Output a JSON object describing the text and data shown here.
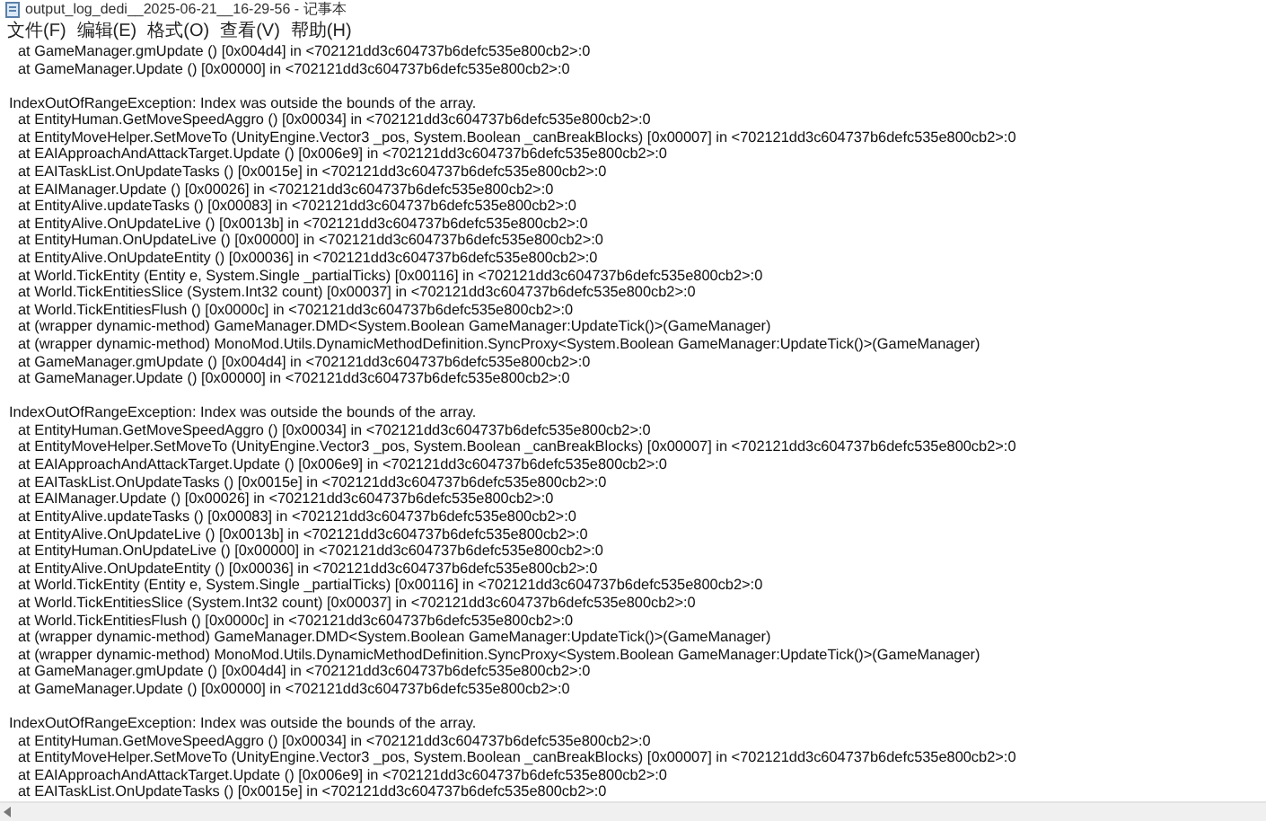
{
  "window": {
    "title": "output_log_dedi__2025-06-21__16-29-56 - 记事本"
  },
  "menu": [
    {
      "label": "文件(F)"
    },
    {
      "label": "编辑(E)"
    },
    {
      "label": "格式(O)"
    },
    {
      "label": "查看(V)"
    },
    {
      "label": "帮助(H)"
    }
  ],
  "log": {
    "blocks": [
      {
        "frames": [
          "at GameManager.gmUpdate () [0x004d4] in <702121dd3c604737b6defc535e800cb2>:0",
          "at GameManager.Update () [0x00000] in <702121dd3c604737b6defc535e800cb2>:0"
        ]
      },
      {
        "header": "IndexOutOfRangeException: Index was outside the bounds of the array.",
        "frames": [
          "at EntityHuman.GetMoveSpeedAggro () [0x00034] in <702121dd3c604737b6defc535e800cb2>:0",
          "at EntityMoveHelper.SetMoveTo (UnityEngine.Vector3 _pos, System.Boolean _canBreakBlocks) [0x00007] in <702121dd3c604737b6defc535e800cb2>:0",
          "at EAIApproachAndAttackTarget.Update () [0x006e9] in <702121dd3c604737b6defc535e800cb2>:0",
          "at EAITaskList.OnUpdateTasks () [0x0015e] in <702121dd3c604737b6defc535e800cb2>:0",
          "at EAIManager.Update () [0x00026] in <702121dd3c604737b6defc535e800cb2>:0",
          "at EntityAlive.updateTasks () [0x00083] in <702121dd3c604737b6defc535e800cb2>:0",
          "at EntityAlive.OnUpdateLive () [0x0013b] in <702121dd3c604737b6defc535e800cb2>:0",
          "at EntityHuman.OnUpdateLive () [0x00000] in <702121dd3c604737b6defc535e800cb2>:0",
          "at EntityAlive.OnUpdateEntity () [0x00036] in <702121dd3c604737b6defc535e800cb2>:0",
          "at World.TickEntity (Entity e, System.Single _partialTicks) [0x00116] in <702121dd3c604737b6defc535e800cb2>:0",
          "at World.TickEntitiesSlice (System.Int32 count) [0x00037] in <702121dd3c604737b6defc535e800cb2>:0",
          "at World.TickEntitiesFlush () [0x0000c] in <702121dd3c604737b6defc535e800cb2>:0",
          "at (wrapper dynamic-method) GameManager.DMD<System.Boolean GameManager:UpdateTick()>(GameManager)",
          "at (wrapper dynamic-method) MonoMod.Utils.DynamicMethodDefinition.SyncProxy<System.Boolean GameManager:UpdateTick()>(GameManager)",
          "at GameManager.gmUpdate () [0x004d4] in <702121dd3c604737b6defc535e800cb2>:0",
          "at GameManager.Update () [0x00000] in <702121dd3c604737b6defc535e800cb2>:0"
        ]
      },
      {
        "header": "IndexOutOfRangeException: Index was outside the bounds of the array.",
        "frames": [
          "at EntityHuman.GetMoveSpeedAggro () [0x00034] in <702121dd3c604737b6defc535e800cb2>:0",
          "at EntityMoveHelper.SetMoveTo (UnityEngine.Vector3 _pos, System.Boolean _canBreakBlocks) [0x00007] in <702121dd3c604737b6defc535e800cb2>:0",
          "at EAIApproachAndAttackTarget.Update () [0x006e9] in <702121dd3c604737b6defc535e800cb2>:0",
          "at EAITaskList.OnUpdateTasks () [0x0015e] in <702121dd3c604737b6defc535e800cb2>:0",
          "at EAIManager.Update () [0x00026] in <702121dd3c604737b6defc535e800cb2>:0",
          "at EntityAlive.updateTasks () [0x00083] in <702121dd3c604737b6defc535e800cb2>:0",
          "at EntityAlive.OnUpdateLive () [0x0013b] in <702121dd3c604737b6defc535e800cb2>:0",
          "at EntityHuman.OnUpdateLive () [0x00000] in <702121dd3c604737b6defc535e800cb2>:0",
          "at EntityAlive.OnUpdateEntity () [0x00036] in <702121dd3c604737b6defc535e800cb2>:0",
          "at World.TickEntity (Entity e, System.Single _partialTicks) [0x00116] in <702121dd3c604737b6defc535e800cb2>:0",
          "at World.TickEntitiesSlice (System.Int32 count) [0x00037] in <702121dd3c604737b6defc535e800cb2>:0",
          "at World.TickEntitiesFlush () [0x0000c] in <702121dd3c604737b6defc535e800cb2>:0",
          "at (wrapper dynamic-method) GameManager.DMD<System.Boolean GameManager:UpdateTick()>(GameManager)",
          "at (wrapper dynamic-method) MonoMod.Utils.DynamicMethodDefinition.SyncProxy<System.Boolean GameManager:UpdateTick()>(GameManager)",
          "at GameManager.gmUpdate () [0x004d4] in <702121dd3c604737b6defc535e800cb2>:0",
          "at GameManager.Update () [0x00000] in <702121dd3c604737b6defc535e800cb2>:0"
        ]
      },
      {
        "header": "IndexOutOfRangeException: Index was outside the bounds of the array.",
        "frames": [
          "at EntityHuman.GetMoveSpeedAggro () [0x00034] in <702121dd3c604737b6defc535e800cb2>:0",
          "at EntityMoveHelper.SetMoveTo (UnityEngine.Vector3 _pos, System.Boolean _canBreakBlocks) [0x00007] in <702121dd3c604737b6defc535e800cb2>:0",
          "at EAIApproachAndAttackTarget.Update () [0x006e9] in <702121dd3c604737b6defc535e800cb2>:0",
          "at EAITaskList.OnUpdateTasks () [0x0015e] in <702121dd3c604737b6defc535e800cb2>:0"
        ]
      }
    ]
  }
}
